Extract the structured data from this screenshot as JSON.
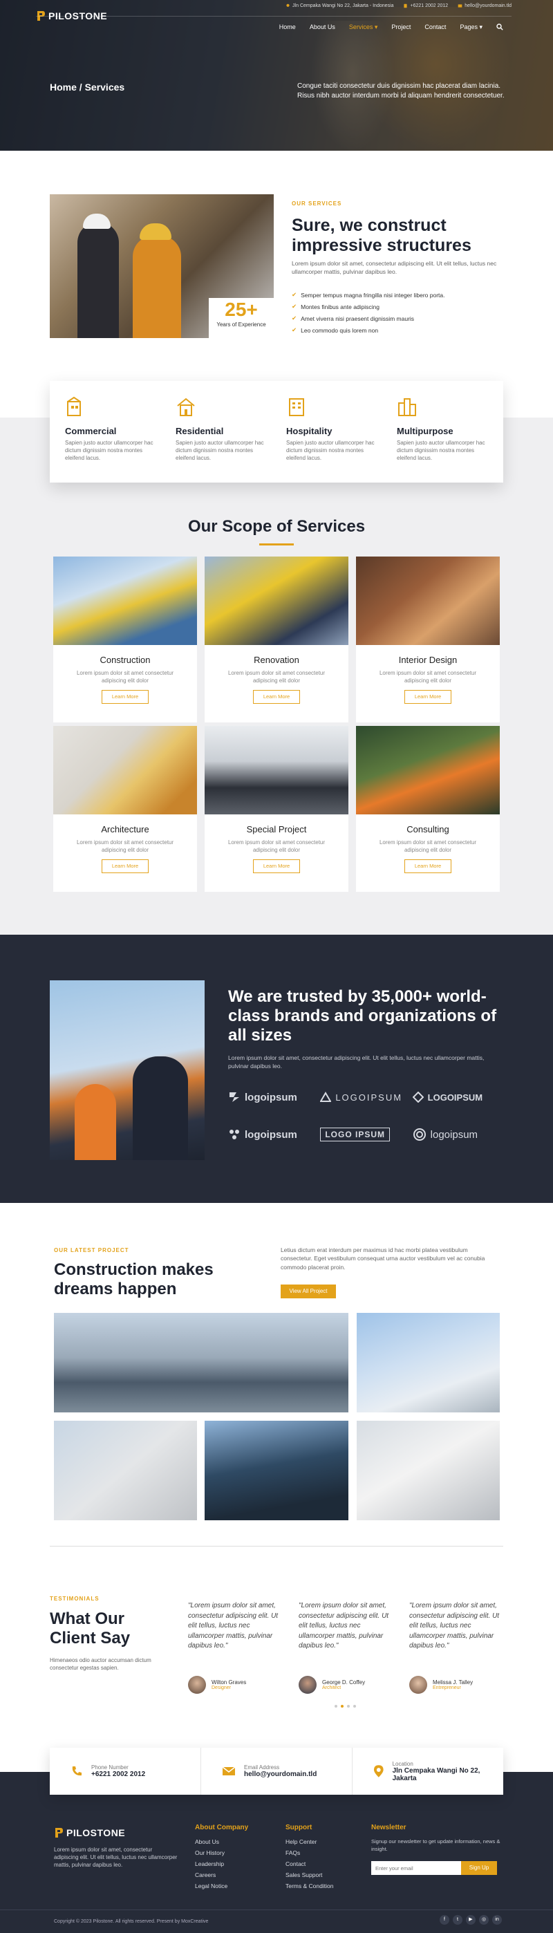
{
  "brand": {
    "name": "PILOSTONE",
    "accent": "#e3a21a",
    "dark": "#262b38"
  },
  "topbar": {
    "address": "Jln Cempaka Wangi No 22, Jakarta - Indonesia",
    "phone": "+6221 2002 2012",
    "email": "hello@yourdomain.tld"
  },
  "nav": {
    "items": [
      "Home",
      "About Us",
      "Services",
      "Project",
      "Contact",
      "Pages"
    ],
    "active": "Services"
  },
  "hero": {
    "breadcrumb": "Home / Services",
    "text": "Congue taciti consectetur duis dignissim hac placerat diam lacinia. Risus nibh auctor interdum morbi id aliquam hendrerit consectetuer."
  },
  "about": {
    "eyebrow": "OUR SERVICES",
    "title": "Sure, we construct impressive structures",
    "desc": "Lorem ipsum dolor sit amet, consectetur adipiscing elit. Ut elit tellus, luctus nec ullamcorper mattis, pulvinar dapibus leo.",
    "years_num": "25+",
    "years_label": "Years of Experience",
    "checks": [
      "Semper tempus magna fringilla nisi integer libero porta.",
      "Montes finibus ante adipiscing",
      "Amet viverra nisi praesent dignissim mauris",
      "Leo commodo quis lorem non"
    ]
  },
  "features": [
    {
      "title": "Commercial",
      "desc": "Sapien justo auctor ullamcorper hac dictum dignissim nostra montes eleifend lacus."
    },
    {
      "title": "Residential",
      "desc": "Sapien justo auctor ullamcorper hac dictum dignissim nostra montes eleifend lacus."
    },
    {
      "title": "Hospitality",
      "desc": "Sapien justo auctor ullamcorper hac dictum dignissim nostra montes eleifend lacus."
    },
    {
      "title": "Multipurpose",
      "desc": "Sapien justo auctor ullamcorper hac dictum dignissim nostra montes eleifend lacus."
    }
  ],
  "scope": {
    "title": "Our Scope of Services",
    "button": "Learn More",
    "desc": "Lorem ipsum dolor sit amet consectetur adipiscing elit dolor",
    "items": [
      "Construction",
      "Renovation",
      "Interior Design",
      "Architecture",
      "Special Project",
      "Consulting"
    ]
  },
  "trusted": {
    "title": "We are trusted by 35,000+ world-class brands and organizations of all sizes",
    "desc": "Lorem ipsum dolor sit amet, consectetur adipiscing elit. Ut elit tellus, luctus nec ullamcorper mattis, pulvinar dapibus leo.",
    "logos": [
      "logoipsum",
      "LOGOIPSUM",
      "LOGOIPSUM",
      "logoipsum",
      "LOGO IPSUM",
      "logoipsum"
    ]
  },
  "project": {
    "eyebrow": "OUR LATEST PROJECT",
    "title": "Construction makes dreams happen",
    "desc": "Letius dictum erat interdum per maximus id hac morbi platea vestibulum consectetur. Eget vestibulum consequat urna auctor vestibulum vel ac conubia commodo placerat proin.",
    "button": "View All Project"
  },
  "testimonials": {
    "eyebrow": "TESTIMONIALS",
    "title": "What Our Client Say",
    "desc": "Himenaeos odio auctor accumsan dictum consectetur egestas sapien.",
    "quote": "\"Lorem ipsum dolor sit amet, consectetur adipiscing elit. Ut elit tellus, luctus nec ullamcorper mattis, pulvinar dapibus leo.\"",
    "items": [
      {
        "name": "Wilton Graves",
        "role": "Designer"
      },
      {
        "name": "George D. Coffey",
        "role": "Architect"
      },
      {
        "name": "Melissa J. Talley",
        "role": "Entrepreneur"
      }
    ]
  },
  "contact": [
    {
      "label": "Phone Number",
      "value": "+6221 2002 2012"
    },
    {
      "label": "Email Address",
      "value": "hello@yourdomain.tld"
    },
    {
      "label": "Location",
      "value": "Jln Cempaka Wangi No 22, Jakarta"
    }
  ],
  "footer": {
    "about": "Lorem ipsum dolor sit amet, consectetur adipiscing elit. Ut elit tellus, luctus nec ullamcorper mattis, pulvinar dapibus leo.",
    "company_title": "About Company",
    "company": [
      "About Us",
      "Our History",
      "Leadership",
      "Careers",
      "Legal Notice"
    ],
    "support_title": "Support",
    "support": [
      "Help Center",
      "FAQs",
      "Contact",
      "Sales Support",
      "Terms & Condition"
    ],
    "newsletter_title": "Newsletter",
    "newsletter_desc": "Signup our newsletter to get update information, news & insight.",
    "email_placeholder": "Enter your email",
    "signup": "Sign Up",
    "copyright": "Copyright © 2023 Pilostone. All rights reserved. Present by MoxCreative",
    "social": [
      "f",
      "t",
      "▶",
      "◎",
      "in"
    ]
  }
}
